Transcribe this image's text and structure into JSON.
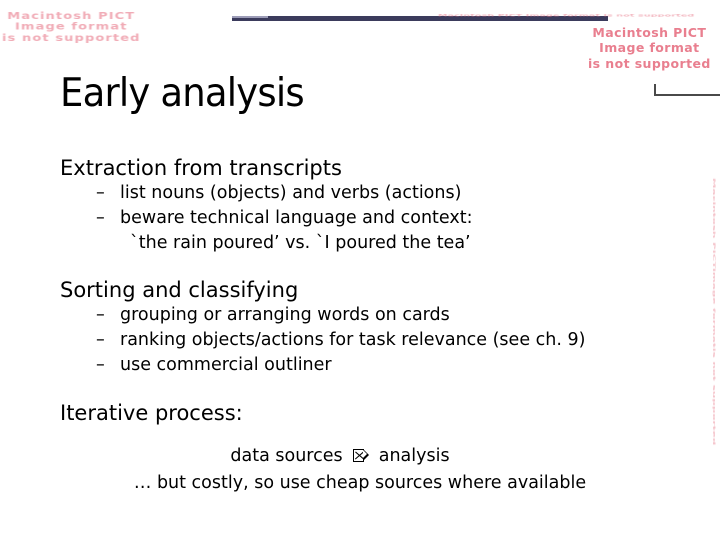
{
  "slide": {
    "title": "Early analysis",
    "decor": {
      "rule_color": "#3b3b5c",
      "corner_rule_color": "#4a4a4a"
    },
    "placeholders": {
      "pict_text": "Macintosh PICT Image format is not supported",
      "pict_line1": "Macintosh PICT",
      "pict_line2": "Image format",
      "pict_line3": "is not supported",
      "pict_color": "#e8798a"
    },
    "sections": [
      {
        "heading": "Extraction from transcripts",
        "bullets": [
          {
            "dash": "–",
            "text": "list nouns (objects) and verbs (actions)"
          },
          {
            "dash": "–",
            "text": "beware technical language and context:"
          }
        ],
        "continuation": "`the rain poured’  vs.  `I poured the tea’"
      },
      {
        "heading": "Sorting and classifying",
        "bullets": [
          {
            "dash": "–",
            "text": "grouping or arranging words on cards"
          },
          {
            "dash": "–",
            "text": "ranking objects/actions for task relevance (see ch. 9)"
          },
          {
            "dash": "–",
            "text": "use commercial outliner"
          }
        ]
      },
      {
        "heading": "Iterative process:",
        "centered_lines": [
          {
            "before": "data sources ",
            "glyph": "arrow-tofu-glyph",
            "after": " analysis"
          },
          {
            "text": "… but costly, so use cheap sources where available"
          }
        ]
      }
    ]
  }
}
